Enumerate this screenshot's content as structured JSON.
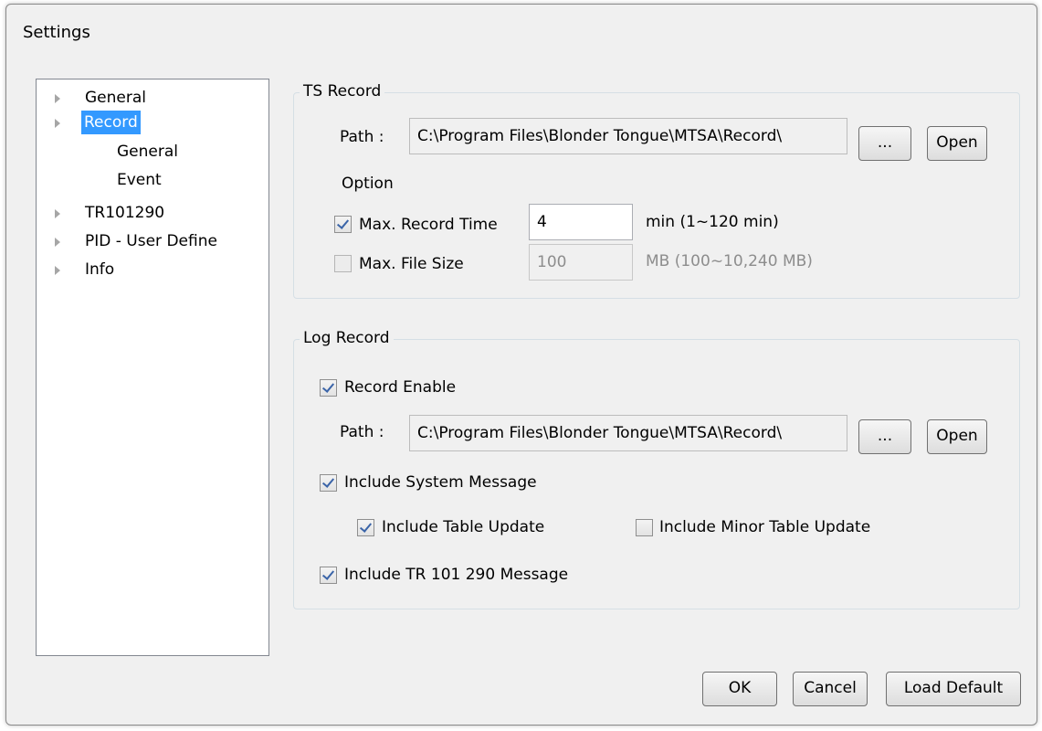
{
  "window": {
    "title": "Settings"
  },
  "tree": {
    "items": [
      {
        "label": "General"
      },
      {
        "label": "Record"
      },
      {
        "label": "General"
      },
      {
        "label": "Event"
      },
      {
        "label": "TR101290"
      },
      {
        "label": "PID - User Define"
      },
      {
        "label": "Info"
      }
    ]
  },
  "ts_record": {
    "legend": "TS Record",
    "path_label": "Path :",
    "path_value": "C:\\Program Files\\Blonder Tongue\\MTSA\\Record\\",
    "browse_label": "...",
    "open_label": "Open",
    "option_label": "Option",
    "max_time": {
      "checked": true,
      "label": "Max. Record Time",
      "value": "4",
      "unit": "min (1~120 min)"
    },
    "max_size": {
      "checked": false,
      "label": "Max. File Size",
      "value": "100",
      "unit": "MB (100~10,240 MB)"
    }
  },
  "log_record": {
    "legend": "Log Record",
    "enable": {
      "checked": true,
      "label": "Record Enable"
    },
    "path_label": "Path :",
    "path_value": "C:\\Program Files\\Blonder Tongue\\MTSA\\Record\\",
    "browse_label": "...",
    "open_label": "Open",
    "system_msg": {
      "checked": true,
      "label": "Include System Message"
    },
    "table_update": {
      "checked": true,
      "label": "Include Table Update"
    },
    "minor_table_update": {
      "checked": false,
      "label": "Include Minor Table Update"
    },
    "tr_msg": {
      "checked": true,
      "label": "Include TR 101 290 Message"
    }
  },
  "footer": {
    "ok_label": "OK",
    "cancel_label": "Cancel",
    "load_default_label": "Load Default"
  }
}
